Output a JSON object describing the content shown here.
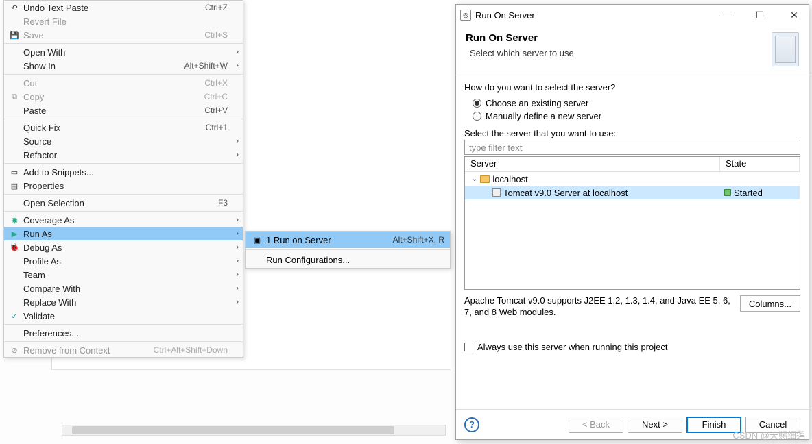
{
  "context_menu": {
    "items": [
      {
        "label": "Undo Text Paste",
        "accel": "Ctrl+Z",
        "icon": "↶"
      },
      {
        "label": "Revert File",
        "disabled": true
      },
      {
        "label": "Save",
        "accel": "Ctrl+S",
        "disabled": true,
        "icon": "💾"
      },
      {
        "sep": true
      },
      {
        "label": "Open With",
        "submenu": true
      },
      {
        "label": "Show In",
        "accel": "Alt+Shift+W",
        "submenu": true
      },
      {
        "sep": true
      },
      {
        "label": "Cut",
        "accel": "Ctrl+X",
        "disabled": true
      },
      {
        "label": "Copy",
        "accel": "Ctrl+C",
        "disabled": true,
        "icon": "⧉"
      },
      {
        "label": "Paste",
        "accel": "Ctrl+V"
      },
      {
        "sep": true
      },
      {
        "label": "Quick Fix",
        "accel": "Ctrl+1"
      },
      {
        "label": "Source",
        "submenu": true
      },
      {
        "label": "Refactor",
        "submenu": true
      },
      {
        "sep": true
      },
      {
        "label": "Add to Snippets...",
        "icon": "▭"
      },
      {
        "label": "Properties",
        "icon": "▤"
      },
      {
        "sep": true
      },
      {
        "label": "Open Selection",
        "accel": "F3"
      },
      {
        "sep": true
      },
      {
        "label": "Coverage As",
        "submenu": true,
        "icon": "◉",
        "iconColor": "#2a8"
      },
      {
        "label": "Run As",
        "submenu": true,
        "selected": true,
        "icon": "▶",
        "iconColor": "#2a8"
      },
      {
        "label": "Debug As",
        "submenu": true,
        "icon": "🐞",
        "iconColor": "#2a8"
      },
      {
        "label": "Profile As",
        "submenu": true
      },
      {
        "label": "Team",
        "submenu": true
      },
      {
        "label": "Compare With",
        "submenu": true
      },
      {
        "label": "Replace With",
        "submenu": true
      },
      {
        "label": "Validate",
        "icon": "✓",
        "iconColor": "#29a"
      },
      {
        "sep": true
      },
      {
        "label": "Preferences..."
      },
      {
        "sep": true
      },
      {
        "label": "Remove from Context",
        "accel": "Ctrl+Alt+Shift+Down",
        "disabled": true,
        "icon": "⊘"
      }
    ]
  },
  "submenu": {
    "items": [
      {
        "label": "1 Run on Server",
        "accel": "Alt+Shift+X, R",
        "selected": true,
        "icon": "▣"
      },
      {
        "sep": true
      },
      {
        "label": "Run Configurations..."
      }
    ]
  },
  "dialog": {
    "title": "Run On Server",
    "header_title": "Run On Server",
    "header_sub": "Select which server to use",
    "question": "How do you want to select the server?",
    "radio1": "Choose an existing server",
    "radio2": "Manually define a new server",
    "select_label": "Select the server that you want to use:",
    "filter_placeholder": "type filter text",
    "col_server": "Server",
    "col_state": "State",
    "tree": {
      "host": "localhost",
      "server": "Tomcat v9.0 Server at localhost",
      "state": "Started"
    },
    "desc": "Apache Tomcat v9.0 supports J2EE 1.2, 1.3, 1.4, and Java EE 5, 6, 7, and 8 Web modules.",
    "columns_btn": "Columns...",
    "always_check": "Always use this server when running this project",
    "back": "< Back",
    "next": "Next >",
    "finish": "Finish",
    "cancel": "Cancel"
  },
  "watermark": "CSDN @天赐细莲"
}
